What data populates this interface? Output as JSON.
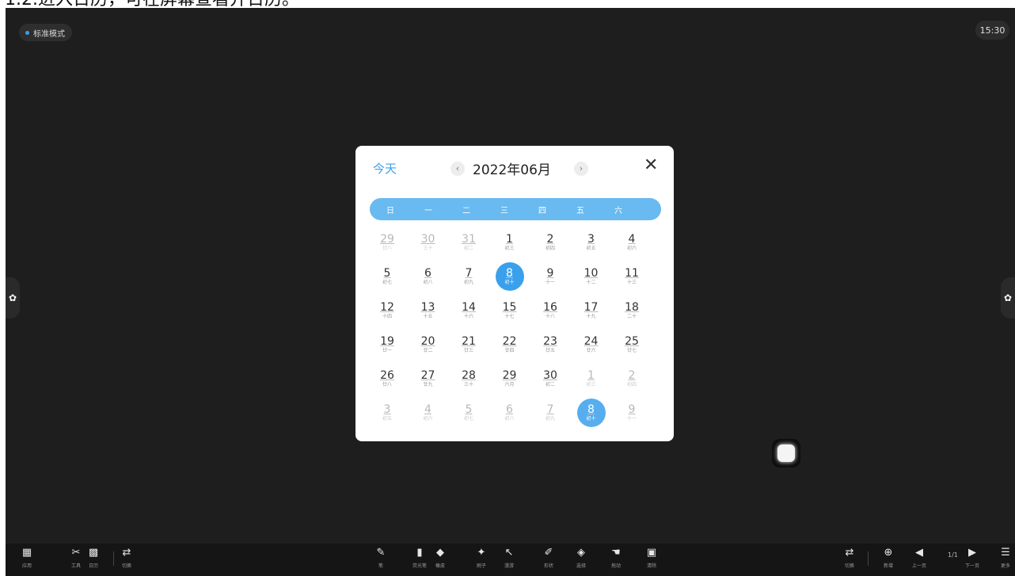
{
  "caption": "1.2.进入日历，可在屏幕查看并日历。",
  "mode_label": "标准模式",
  "clock": "15:30",
  "calendar": {
    "today_label": "今天",
    "title": "2022年06月",
    "prev_icon": "‹",
    "next_icon": "›",
    "close_icon": "✕",
    "weekdays": [
      "日",
      "一",
      "二",
      "三",
      "四",
      "五",
      "六"
    ],
    "weeks": [
      [
        {
          "n": "29",
          "l": "廿八",
          "o": true
        },
        {
          "n": "30",
          "l": "三十",
          "o": true
        },
        {
          "n": "31",
          "l": "初二",
          "o": true
        },
        {
          "n": "1",
          "l": "初三"
        },
        {
          "n": "2",
          "l": "初四"
        },
        {
          "n": "3",
          "l": "初五"
        },
        {
          "n": "4",
          "l": "初六"
        }
      ],
      [
        {
          "n": "5",
          "l": "初七"
        },
        {
          "n": "6",
          "l": "初八"
        },
        {
          "n": "7",
          "l": "初九"
        },
        {
          "n": "8",
          "l": "初十",
          "s": true
        },
        {
          "n": "9",
          "l": "十一"
        },
        {
          "n": "10",
          "l": "十二"
        },
        {
          "n": "11",
          "l": "十三"
        }
      ],
      [
        {
          "n": "12",
          "l": "十四"
        },
        {
          "n": "13",
          "l": "十五"
        },
        {
          "n": "14",
          "l": "十六"
        },
        {
          "n": "15",
          "l": "十七"
        },
        {
          "n": "16",
          "l": "十八"
        },
        {
          "n": "17",
          "l": "十九"
        },
        {
          "n": "18",
          "l": "二十"
        }
      ],
      [
        {
          "n": "19",
          "l": "廿一"
        },
        {
          "n": "20",
          "l": "廿二"
        },
        {
          "n": "21",
          "l": "廿三"
        },
        {
          "n": "22",
          "l": "廿四"
        },
        {
          "n": "23",
          "l": "廿五"
        },
        {
          "n": "24",
          "l": "廿六"
        },
        {
          "n": "25",
          "l": "廿七"
        }
      ],
      [
        {
          "n": "26",
          "l": "廿八"
        },
        {
          "n": "27",
          "l": "廿九"
        },
        {
          "n": "28",
          "l": "三十"
        },
        {
          "n": "29",
          "l": "六月"
        },
        {
          "n": "30",
          "l": "初二"
        },
        {
          "n": "1",
          "l": "初三",
          "o": true
        },
        {
          "n": "2",
          "l": "初四",
          "o": true
        }
      ],
      [
        {
          "n": "3",
          "l": "初五",
          "o": true
        },
        {
          "n": "4",
          "l": "初六",
          "o": true
        },
        {
          "n": "5",
          "l": "初七",
          "o": true
        },
        {
          "n": "6",
          "l": "初八",
          "o": true
        },
        {
          "n": "7",
          "l": "初九",
          "o": true
        },
        {
          "n": "8",
          "l": "初十",
          "o": true,
          "s": true
        },
        {
          "n": "9",
          "l": "十一",
          "o": true
        }
      ]
    ]
  },
  "toolbar": {
    "left": [
      {
        "icon": "▦",
        "label": "应用"
      },
      {
        "icon": "✂",
        "label": "工具"
      },
      {
        "icon": "▩",
        "label": "日历"
      },
      {
        "icon": "⇄",
        "label": "切换"
      }
    ],
    "center": [
      {
        "icon": "✎",
        "label": "笔"
      },
      {
        "icon": "▮",
        "label": "荧光笔"
      },
      {
        "icon": "◆",
        "label": "橡皮"
      },
      {
        "icon": "✦",
        "label": "刷子"
      },
      {
        "icon": "↖",
        "label": "漫游"
      },
      {
        "icon": "✐",
        "label": "形状"
      },
      {
        "icon": "◈",
        "label": "选择"
      },
      {
        "icon": "☚",
        "label": "拖动"
      },
      {
        "icon": "▣",
        "label": "清除"
      }
    ],
    "right": [
      {
        "icon": "⇄",
        "label": "切换"
      },
      {
        "icon": "⊕",
        "label": "新增"
      },
      {
        "icon": "◀",
        "label": "上一页"
      },
      {
        "icon": "▶",
        "label": "下一页"
      },
      {
        "icon": "☰",
        "label": "更多"
      }
    ],
    "page_indicator": "1/1"
  }
}
